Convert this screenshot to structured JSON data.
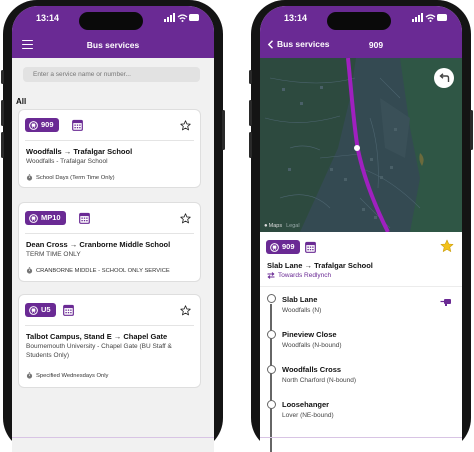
{
  "status_bar": {
    "time": "13:14"
  },
  "list_screen": {
    "title": "Bus services",
    "search": {
      "placeholder": "Enter a service name or number..."
    },
    "section_label": "All",
    "services": [
      {
        "number": "909",
        "from": "Woodfalls",
        "to": "Trafalgar School",
        "subtitle": "Woodfalls - Trafalgar School",
        "note": "School Days (Term Time Only)"
      },
      {
        "number": "MP10",
        "from": "Dean Cross",
        "to": "Cranborne Middle School",
        "subtitle": "TERM TIME ONLY",
        "note": "CRANBORNE MIDDLE - SCHOOL ONLY SERVICE"
      },
      {
        "number": "U5",
        "from": "Talbot Campus, Stand E",
        "to": "Chapel Gate",
        "subtitle": "Bournemouth University - Chapel Gate (BU Staff & Students Only)",
        "note": "Specified Wednesdays Only"
      }
    ]
  },
  "detail_screen": {
    "back_label": "Bus services",
    "title": "909",
    "map": {
      "attribution_brand": "Maps",
      "attribution_legal": "Legal"
    },
    "service_number": "909",
    "route_from": "Slab Lane",
    "route_to": "Trafalgar School",
    "direction": "Towards Redlynch",
    "stops": [
      {
        "name": "Slab Lane",
        "sub": "Woodfalls (N)"
      },
      {
        "name": "Pineview Close",
        "sub": "Woodfalls (N-bound)"
      },
      {
        "name": "Woodfalls Cross",
        "sub": "North Charford (N-bound)"
      },
      {
        "name": "Loosehanger",
        "sub": "Lover (NE-bound)"
      }
    ]
  },
  "colors": {
    "brand_purple": "#6a2a94",
    "star_gold": "#f3c21b",
    "map_route": "#a020c0"
  }
}
